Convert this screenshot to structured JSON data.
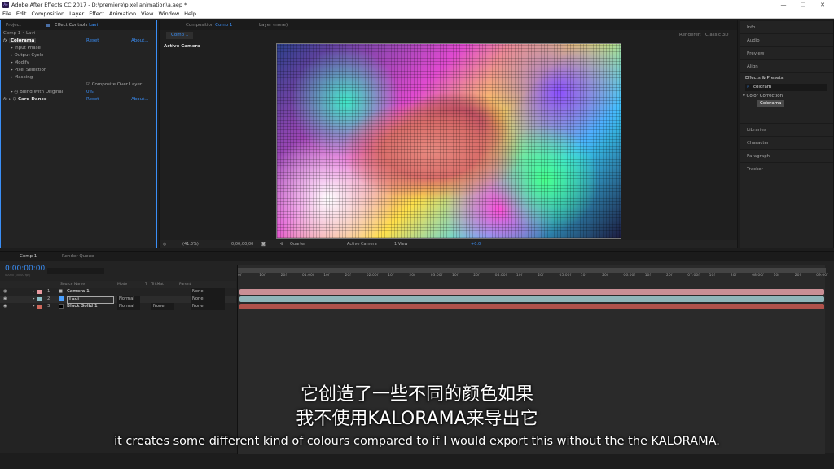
{
  "window": {
    "title": "Adobe After Effects CC 2017 - D:\\premiere\\pixel animation\\a.aep *",
    "min": "—",
    "max": "❐",
    "close": "✕",
    "logo": "Ae"
  },
  "menu": [
    "File",
    "Edit",
    "Composition",
    "Layer",
    "Effect",
    "Animation",
    "View",
    "Window",
    "Help"
  ],
  "project_panel": {
    "project_tab": "Project",
    "effect_controls_tab": "Effect Controls",
    "effect_controls_layer": "Lavi",
    "breadcrumb": "Comp 1 • Lavi",
    "effects": [
      {
        "name": "Colorama",
        "reset": "Reset",
        "about": "About..."
      },
      {
        "name": "Card Dance",
        "reset": "Reset",
        "about": "About..."
      }
    ],
    "colorama_props": [
      "Input Phase",
      "Output Cycle",
      "Modify",
      "Pixel Selection",
      "Masking"
    ],
    "composite_label": "Composite Over Layer",
    "blend_label": "Blend With Original",
    "blend_value": "0%"
  },
  "comp_panel": {
    "tab": "Composition",
    "tab_name": "Comp 1",
    "layer_tab": "Layer (none)",
    "subtab": "Comp 1",
    "renderer_label": "Renderer:",
    "renderer_value": "Classic 3D",
    "view_label": "Active Camera",
    "footer": {
      "zoom": "(41.3%)",
      "timecode": "0;00;00;00",
      "resolution": "Quarter",
      "camera": "Active Camera",
      "views": "1 View",
      "exposure": "+0.0"
    }
  },
  "right_panels": {
    "items_top": [
      "Info",
      "Audio",
      "Preview",
      "Align"
    ],
    "effects_title": "Effects & Presets",
    "search_value": "coloram",
    "category": "Color Correction",
    "result": "Colorama",
    "items_bottom": [
      "Libraries",
      "Character",
      "Paragraph",
      "Tracker"
    ]
  },
  "timeline": {
    "tabs": [
      "Comp 1",
      "Render Queue"
    ],
    "timecode": "0:00:00:00",
    "fps": "00000 (30.00 fps)",
    "headers": {
      "source": "Source Name",
      "mode": "Mode",
      "t": "T",
      "trkmat": "TrkMat",
      "parent": "Parent"
    },
    "layers": [
      {
        "num": "1",
        "name": "Camera 1",
        "mode": "",
        "trkmat": "",
        "parent": "None",
        "color": "#e89aa0",
        "bar": "#c98f95"
      },
      {
        "num": "2",
        "name": "Lavi",
        "mode": "Normal",
        "trkmat": "",
        "parent": "None",
        "color": "#8fc0c8",
        "bar": "#8fb5b9"
      },
      {
        "num": "3",
        "name": "Black Solid 1",
        "mode": "Normal",
        "trkmat": "None",
        "parent": "None",
        "color": "#d0695c",
        "bar": "#b0524b"
      }
    ],
    "ruler": [
      "0f",
      "10f",
      "20f",
      "01:00f",
      "10f",
      "20f",
      "02:00f",
      "10f",
      "20f",
      "03:00f",
      "10f",
      "20f",
      "04:00f",
      "10f",
      "20f",
      "05:00f",
      "10f",
      "20f",
      "06:00f",
      "10f",
      "20f",
      "07:00f",
      "10f",
      "20f",
      "08:00f",
      "10f",
      "20f",
      "09:00f"
    ]
  },
  "subtitles": {
    "zh_line1": "它创造了一些不同的颜色如果",
    "zh_line2": "我不使用KALORAMA来导出它",
    "en": "it creates some different kind of colours compared to if I would export this without the the KALORAMA."
  },
  "colors": {
    "accent": "#3a8ef6",
    "panel": "#232323",
    "bg": "#1d1d1d"
  }
}
